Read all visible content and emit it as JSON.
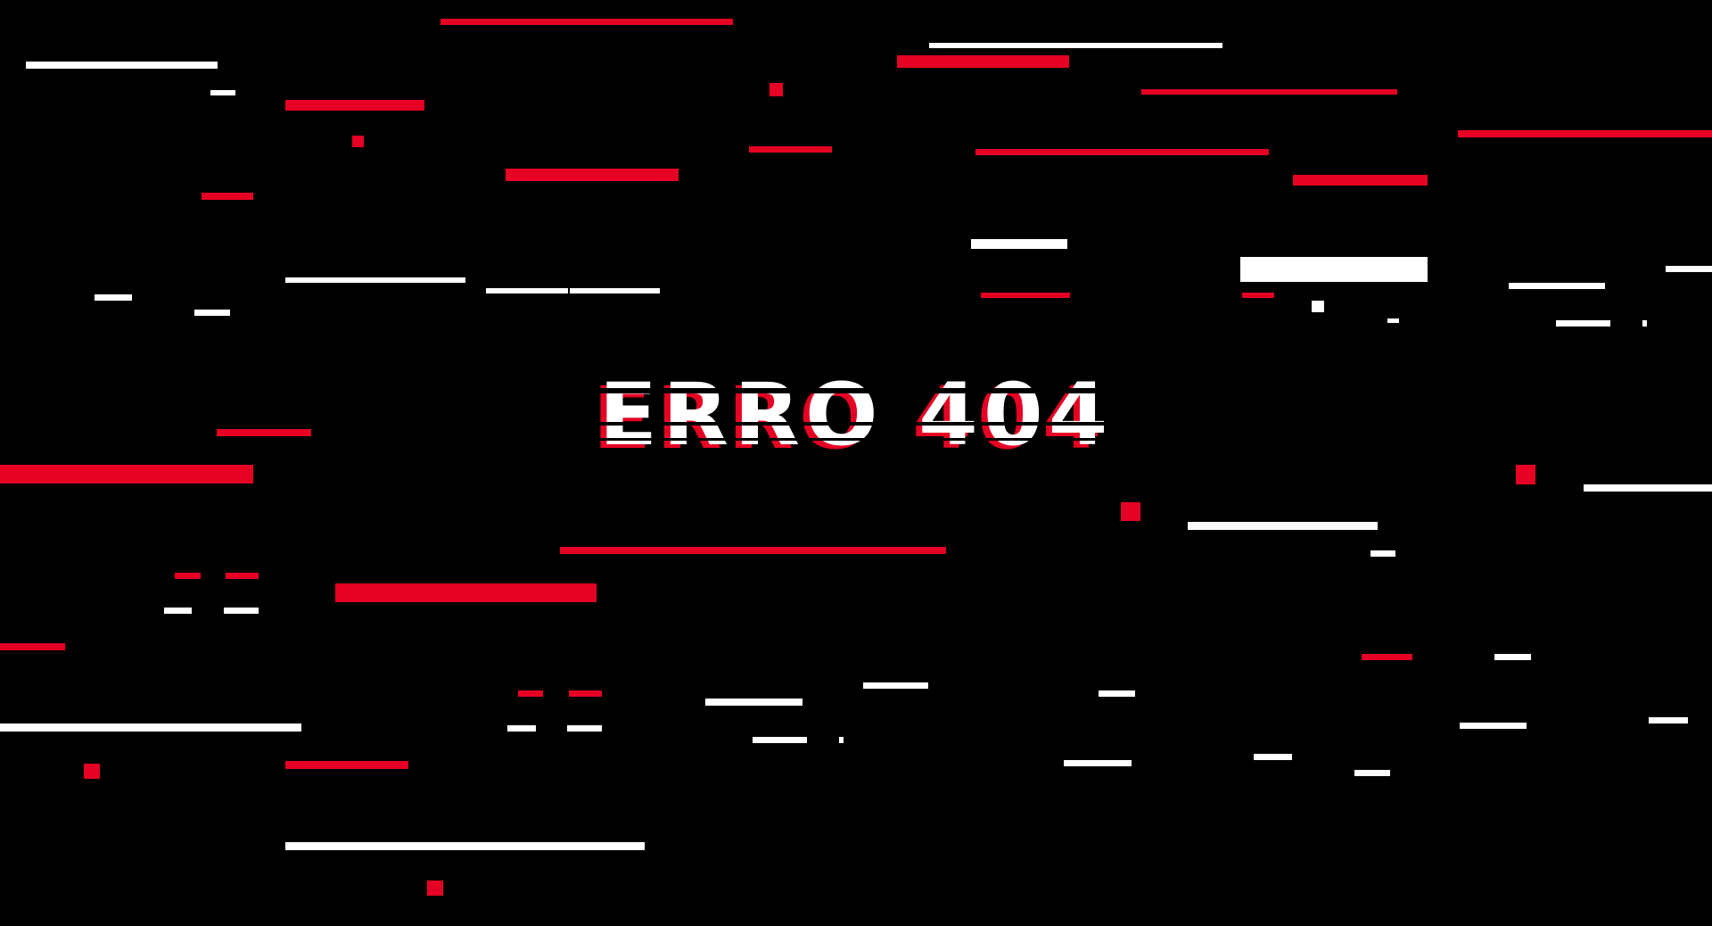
{
  "page": {
    "heading": "ERRO 404"
  },
  "colors": {
    "background": "#000000",
    "accent_red": "#E60023",
    "glitch_white": "#FFFFFF"
  }
}
